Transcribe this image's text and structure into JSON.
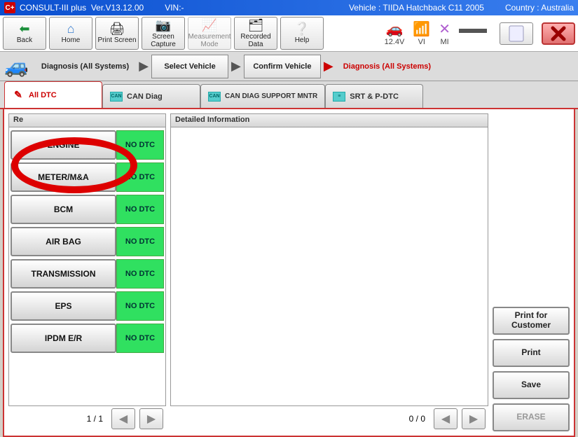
{
  "title": {
    "app": "CONSULT-III plus",
    "ver": "Ver.V13.12.00",
    "vin_label": "VIN:-",
    "vehicle_label": "Vehicle : TIIDA Hatchback C11 2005",
    "country_label": "Country : Australia"
  },
  "toolbar": {
    "back": "Back",
    "home": "Home",
    "print_screen": "Print Screen",
    "screen_cap": "Screen Capture",
    "meas_mode": "Measurement Mode",
    "recorded_data": "Recorded Data",
    "help": "Help"
  },
  "status": {
    "voltage": "12.4V",
    "vi": "VI",
    "mi": "MI"
  },
  "breadcrumb": {
    "step1": "Diagnosis (All Systems)",
    "step2": "Select Vehicle",
    "step3": "Confirm Vehicle",
    "step4": "Diagnosis (All Systems)"
  },
  "tabs": {
    "all_dtc": "All DTC",
    "can_diag": "CAN Diag",
    "can_support": "CAN DIAG SUPPORT MNTR",
    "srt": "SRT & P-DTC"
  },
  "left": {
    "header": "Re",
    "systems": [
      {
        "name": "ENGINE",
        "status": "NO DTC"
      },
      {
        "name": "METER/M&A",
        "status": "NO DTC"
      },
      {
        "name": "BCM",
        "status": "NO DTC"
      },
      {
        "name": "AIR BAG",
        "status": "NO DTC"
      },
      {
        "name": "TRANSMISSION",
        "status": "NO DTC"
      },
      {
        "name": "EPS",
        "status": "NO DTC"
      },
      {
        "name": "IPDM E/R",
        "status": "NO DTC"
      }
    ],
    "pager": "1 / 1"
  },
  "detail": {
    "header": "Detailed Information",
    "pager": "0 / 0"
  },
  "actions": {
    "print_customer": "Print for Customer",
    "print": "Print",
    "save": "Save",
    "erase": "ERASE"
  }
}
